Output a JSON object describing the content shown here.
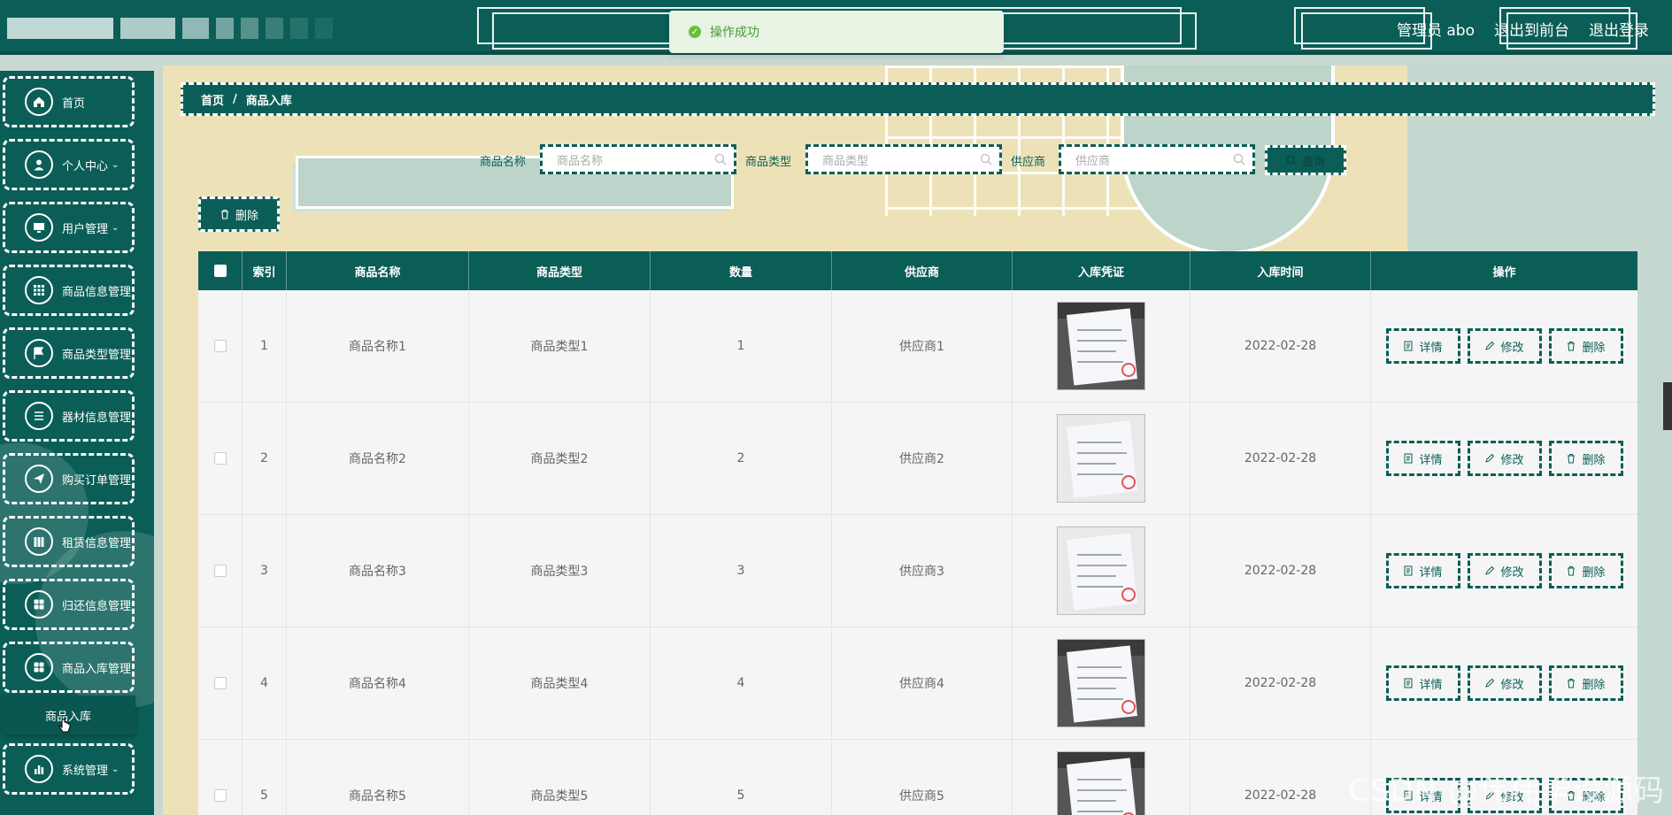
{
  "topbar": {
    "toast": "操作成功",
    "user": "管理员 abo",
    "to_frontend": "退出到前台",
    "logout": "退出登录"
  },
  "sidebar": {
    "items": [
      {
        "label": "首页",
        "icon": "home-icon",
        "chevron": false
      },
      {
        "label": "个人中心",
        "icon": "user-icon",
        "chevron": true
      },
      {
        "label": "用户管理",
        "icon": "monitor-icon",
        "chevron": true
      },
      {
        "label": "商品信息管理",
        "icon": "grid-icon",
        "chevron": false
      },
      {
        "label": "商品类型管理",
        "icon": "flag-icon",
        "chevron": false
      },
      {
        "label": "器材信息管理",
        "icon": "list-icon",
        "chevron": false
      },
      {
        "label": "购买订单管理",
        "icon": "send-icon",
        "chevron": false
      },
      {
        "label": "租赁信息管理",
        "icon": "box-icon",
        "chevron": false
      },
      {
        "label": "归还信息管理",
        "icon": "apps-icon",
        "chevron": false
      },
      {
        "label": "商品入库管理",
        "icon": "apps-icon",
        "chevron": false
      },
      {
        "label": "系统管理",
        "icon": "chart-icon",
        "chevron": true
      }
    ],
    "submenu": "商品入库"
  },
  "breadcrumb": {
    "home": "首页",
    "sep": "/",
    "current": "商品入库"
  },
  "search": {
    "name_label": "商品名称",
    "name_placeholder": "商品名称",
    "type_label": "商品类型",
    "type_placeholder": "商品类型",
    "supplier_label": "供应商",
    "supplier_placeholder": "供应商",
    "query": "查询"
  },
  "toolbar": {
    "delete": "删除"
  },
  "table": {
    "headers": [
      "索引",
      "商品名称",
      "商品类型",
      "数量",
      "供应商",
      "入库凭证",
      "入库时间",
      "操作"
    ],
    "rows": [
      {
        "index": "1",
        "name": "商品名称1",
        "type": "商品类型1",
        "qty": "1",
        "supplier": "供应商1",
        "time": "2022-02-28"
      },
      {
        "index": "2",
        "name": "商品名称2",
        "type": "商品类型2",
        "qty": "2",
        "supplier": "供应商2",
        "time": "2022-02-28"
      },
      {
        "index": "3",
        "name": "商品名称3",
        "type": "商品类型3",
        "qty": "3",
        "supplier": "供应商3",
        "time": "2022-02-28"
      },
      {
        "index": "4",
        "name": "商品名称4",
        "type": "商品类型4",
        "qty": "4",
        "supplier": "供应商4",
        "time": "2022-02-28"
      },
      {
        "index": "5",
        "name": "商品名称5",
        "type": "商品类型5",
        "qty": "5",
        "supplier": "供应商5",
        "time": "2022-02-28"
      }
    ],
    "actions": {
      "detail": "详情",
      "edit": "修改",
      "delete": "删除"
    }
  },
  "watermark": "CSDN @伟伟毕设源码",
  "colors": {
    "primary": "#0b5e57",
    "cream": "#ede2b7",
    "mint": "#c4d8cf",
    "success": "#67c23a"
  }
}
